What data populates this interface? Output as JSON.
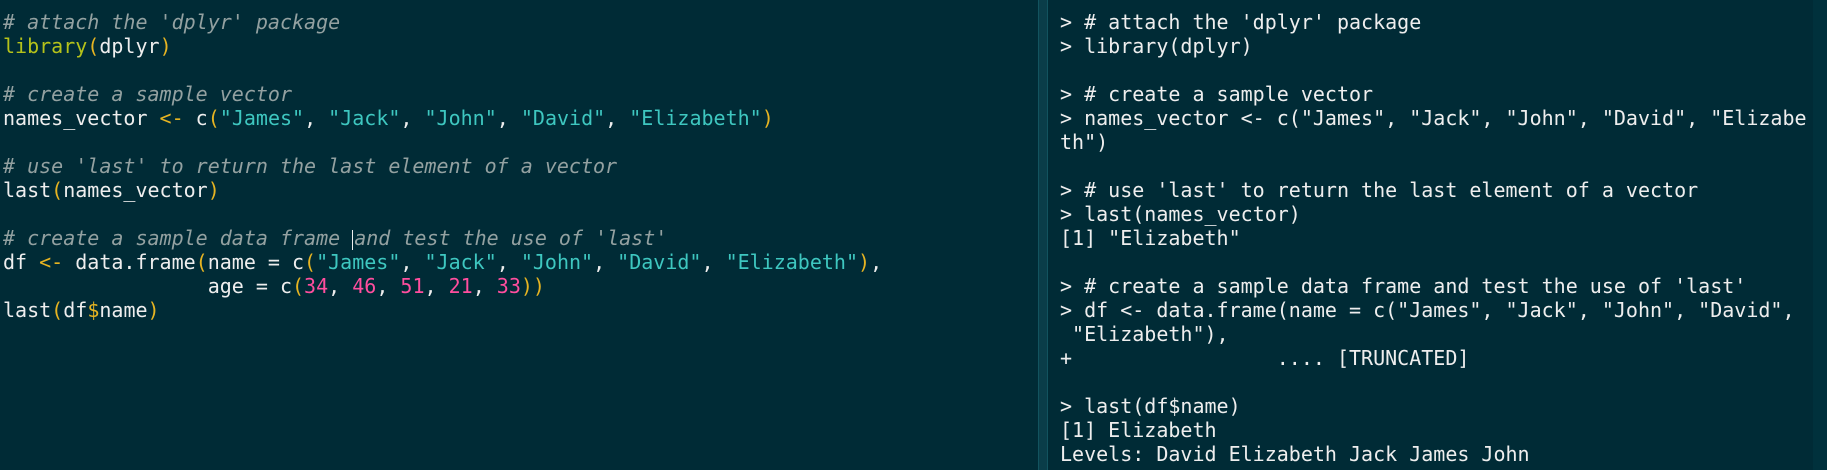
{
  "editor": {
    "lines": [
      {
        "tokens": [
          {
            "t": "# attach the 'dplyr' package",
            "c": "comment"
          }
        ]
      },
      {
        "tokens": [
          {
            "t": "library",
            "c": "func"
          },
          {
            "t": "(",
            "c": "paren"
          },
          {
            "t": "dplyr",
            "c": "plain"
          },
          {
            "t": ")",
            "c": "paren"
          }
        ]
      },
      {
        "tokens": []
      },
      {
        "tokens": [
          {
            "t": "# create a sample vector",
            "c": "comment"
          }
        ]
      },
      {
        "tokens": [
          {
            "t": "names_vector ",
            "c": "plain"
          },
          {
            "t": "<-",
            "c": "op"
          },
          {
            "t": " c",
            "c": "plain"
          },
          {
            "t": "(",
            "c": "paren"
          },
          {
            "t": "\"James\"",
            "c": "str"
          },
          {
            "t": ", ",
            "c": "plain"
          },
          {
            "t": "\"Jack\"",
            "c": "str"
          },
          {
            "t": ", ",
            "c": "plain"
          },
          {
            "t": "\"John\"",
            "c": "str"
          },
          {
            "t": ", ",
            "c": "plain"
          },
          {
            "t": "\"David\"",
            "c": "str"
          },
          {
            "t": ", ",
            "c": "plain"
          },
          {
            "t": "\"Elizabeth\"",
            "c": "str"
          },
          {
            "t": ")",
            "c": "paren"
          }
        ]
      },
      {
        "tokens": []
      },
      {
        "tokens": [
          {
            "t": "# use 'last' to return the last element of a vector",
            "c": "comment"
          }
        ]
      },
      {
        "tokens": [
          {
            "t": "last",
            "c": "plain"
          },
          {
            "t": "(",
            "c": "paren"
          },
          {
            "t": "names_vector",
            "c": "plain"
          },
          {
            "t": ")",
            "c": "paren"
          }
        ]
      },
      {
        "tokens": []
      },
      {
        "tokens": [
          {
            "t": "# create a sample data frame ",
            "c": "comment"
          },
          {
            "t": "",
            "c": "cursor"
          },
          {
            "t": "and test the use of 'last'",
            "c": "comment"
          }
        ]
      },
      {
        "tokens": [
          {
            "t": "df ",
            "c": "plain"
          },
          {
            "t": "<-",
            "c": "op"
          },
          {
            "t": " data.frame",
            "c": "plain"
          },
          {
            "t": "(",
            "c": "paren"
          },
          {
            "t": "name = c",
            "c": "plain"
          },
          {
            "t": "(",
            "c": "paren"
          },
          {
            "t": "\"James\"",
            "c": "str"
          },
          {
            "t": ", ",
            "c": "plain"
          },
          {
            "t": "\"Jack\"",
            "c": "str"
          },
          {
            "t": ", ",
            "c": "plain"
          },
          {
            "t": "\"John\"",
            "c": "str"
          },
          {
            "t": ", ",
            "c": "plain"
          },
          {
            "t": "\"David\"",
            "c": "str"
          },
          {
            "t": ", ",
            "c": "plain"
          },
          {
            "t": "\"Elizabeth\"",
            "c": "str"
          },
          {
            "t": ")",
            "c": "paren"
          },
          {
            "t": ",",
            "c": "plain"
          }
        ]
      },
      {
        "tokens": [
          {
            "t": "                 age = c",
            "c": "plain"
          },
          {
            "t": "(",
            "c": "paren"
          },
          {
            "t": "34",
            "c": "num"
          },
          {
            "t": ", ",
            "c": "plain"
          },
          {
            "t": "46",
            "c": "num"
          },
          {
            "t": ", ",
            "c": "plain"
          },
          {
            "t": "51",
            "c": "num"
          },
          {
            "t": ", ",
            "c": "plain"
          },
          {
            "t": "21",
            "c": "num"
          },
          {
            "t": ", ",
            "c": "plain"
          },
          {
            "t": "33",
            "c": "num"
          },
          {
            "t": "))",
            "c": "paren"
          }
        ]
      },
      {
        "tokens": [
          {
            "t": "last",
            "c": "plain"
          },
          {
            "t": "(",
            "c": "paren"
          },
          {
            "t": "df",
            "c": "plain"
          },
          {
            "t": "$",
            "c": "dollar"
          },
          {
            "t": "name",
            "c": "plain"
          },
          {
            "t": ")",
            "c": "paren"
          }
        ]
      }
    ]
  },
  "console": {
    "lines": [
      "> # attach the 'dplyr' package",
      "> library(dplyr)",
      "",
      "> # create a sample vector",
      "> names_vector <- c(\"James\", \"Jack\", \"John\", \"David\", \"Elizabe",
      "th\")",
      "",
      "> # use 'last' to return the last element of a vector",
      "> last(names_vector)",
      "[1] \"Elizabeth\"",
      "",
      "> # create a sample data frame and test the use of 'last'",
      "> df <- data.frame(name = c(\"James\", \"Jack\", \"John\", \"David\",",
      " \"Elizabeth\"),",
      "+                 .... [TRUNCATED]",
      "",
      "> last(df$name)",
      "[1] Elizabeth",
      "Levels: David Elizabeth Jack James John"
    ]
  }
}
